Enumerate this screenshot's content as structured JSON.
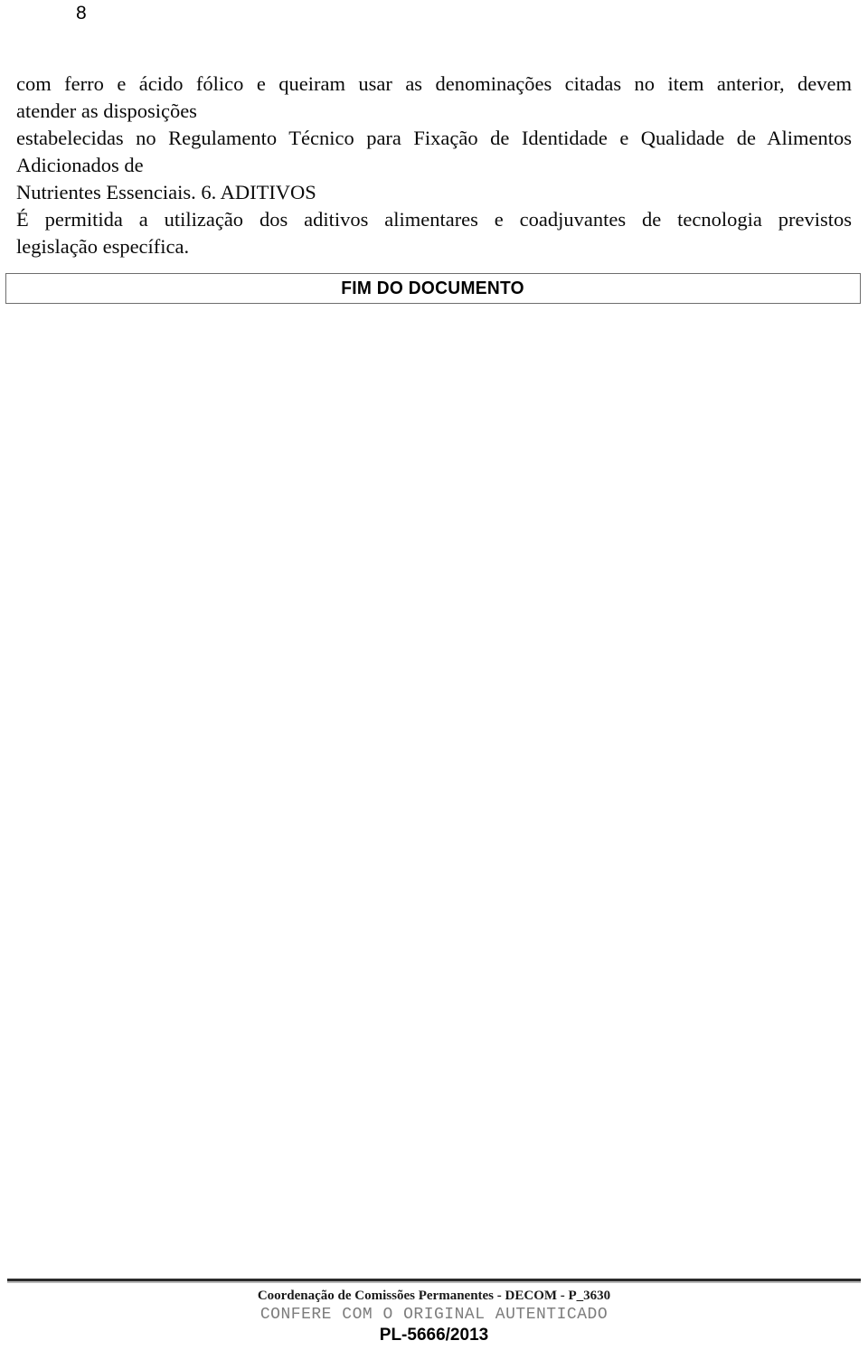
{
  "page": {
    "number": "8",
    "paper_color": "#ffffff",
    "text_color": "#0a0a0a"
  },
  "body": {
    "lines": [
      "com ferro e ácido fólico e queiram usar as denominações citadas no item anterior, devem",
      "atender as disposições",
      "estabelecidas no Regulamento Técnico para Fixação de Identidade e Qualidade de Alimentos",
      "Adicionados de",
      "Nutrientes Essenciais. 6. ADITIVOS",
      "É permitida a utilização dos aditivos alimentares e coadjuvantes de tecnologia previstos",
      "legislação específica."
    ]
  },
  "end_box": {
    "label": "FIM DO DOCUMENTO",
    "border_color": "#6e6e6e"
  },
  "footer": {
    "line1": "Coordenação de Comissões Permanentes - DECOM - P_3630",
    "line2": "CONFERE COM O ORIGINAL AUTENTICADO",
    "line3": "PL-5666/2013",
    "rule_color": "#2b2b2b",
    "stamp_color": "#7d7d7d"
  }
}
